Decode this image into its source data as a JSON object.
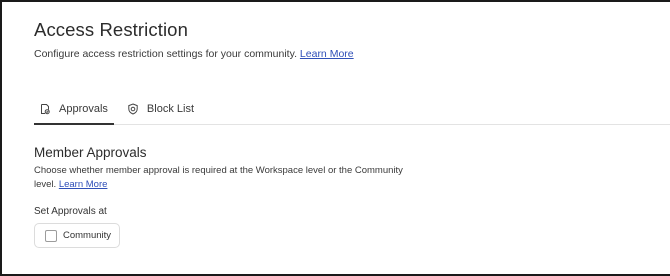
{
  "header": {
    "title": "Access Restriction",
    "subtitle": "Configure access restriction settings for your community.",
    "learn_more": "Learn More"
  },
  "tabs": [
    {
      "label": "Approvals",
      "icon": "document-check-icon",
      "active": true
    },
    {
      "label": "Block List",
      "icon": "shield-icon",
      "active": false
    }
  ],
  "member_approvals": {
    "title": "Member Approvals",
    "description": "Choose whether member approval is required at the Workspace level or the Community level.",
    "learn_more": "Learn More",
    "field_label": "Set Approvals at",
    "option": {
      "label": "Community",
      "checked": false
    }
  }
}
